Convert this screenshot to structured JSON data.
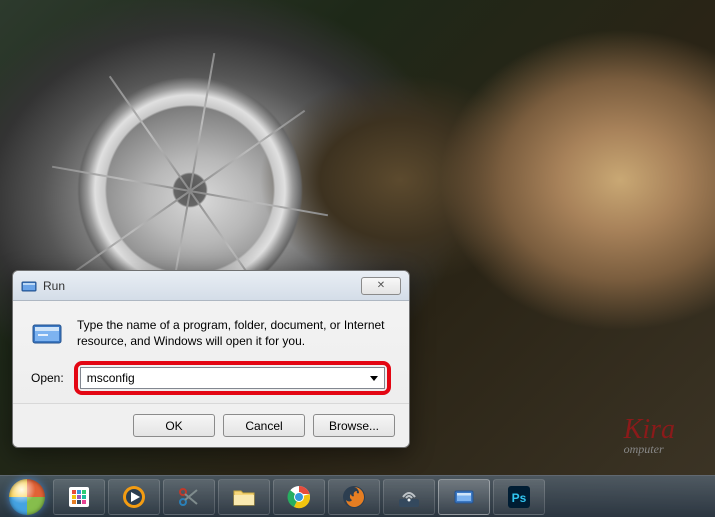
{
  "dialog": {
    "title": "Run",
    "body_text": "Type the name of a program, folder, document, or Internet resource, and Windows will open it for you.",
    "open_label": "Open:",
    "input_value": "msconfig",
    "buttons": {
      "ok": "OK",
      "cancel": "Cancel",
      "browse": "Browse..."
    }
  },
  "watermark": {
    "name": "Kira",
    "sub": "omputer"
  },
  "taskbar": {
    "items": [
      {
        "name": "start",
        "icon": "windows-logo"
      },
      {
        "name": "apps-grid",
        "icon": "grid"
      },
      {
        "name": "media-player",
        "icon": "wmp"
      },
      {
        "name": "snipping-tool",
        "icon": "snip"
      },
      {
        "name": "file-explorer",
        "icon": "folder"
      },
      {
        "name": "chrome",
        "icon": "chrome"
      },
      {
        "name": "firefox",
        "icon": "firefox"
      },
      {
        "name": "network",
        "icon": "wifi"
      },
      {
        "name": "run",
        "icon": "run-small",
        "running": true
      },
      {
        "name": "photoshop",
        "icon": "ps"
      }
    ]
  }
}
